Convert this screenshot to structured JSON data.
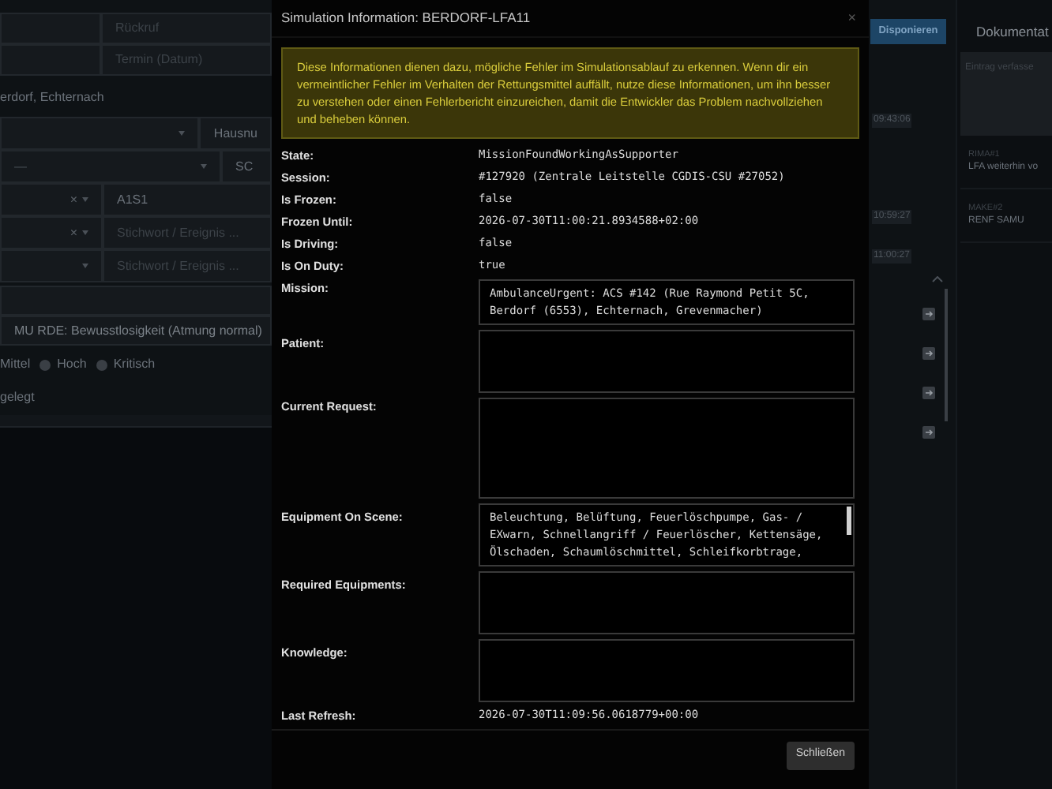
{
  "background": {
    "left": {
      "callback_placeholder": "Rückruf",
      "date_placeholder": "Termin (Datum)",
      "address": "erdorf, Echternach",
      "rows": [
        {
          "kind": "wide",
          "side_value": "Hausnu"
        },
        {
          "kind": "wide",
          "select_value": "—",
          "side_value": "SC"
        },
        {
          "kind": "narrow",
          "clear": "×",
          "side_value": "A1S1"
        },
        {
          "kind": "narrow",
          "clear": "×",
          "side_placeholder": "Stichwort / Ereignis ..."
        },
        {
          "kind": "narrow",
          "side_placeholder": "Stichwort / Ereignis ..."
        }
      ],
      "keyword": "MU RDE: Bewusstlosigkeit (Atmung normal)",
      "priority_cut_label": "Mittel",
      "priority_options": [
        {
          "label": "Hoch",
          "selected": false
        },
        {
          "label": "Kritisch",
          "selected": false
        }
      ],
      "status": "gelegt"
    },
    "right": {
      "dispatch_button": "Disponieren",
      "times": [
        "09:43:06",
        "10:59:27",
        "11:00:27"
      ],
      "documentation_title": "Dokumentat",
      "entry_placeholder": "Eintrag verfasse",
      "entries": [
        {
          "tag": "RIMA#1",
          "text": "LFA weiterhin vo"
        },
        {
          "tag": "MAKE#2",
          "text": "RENF SAMU"
        }
      ]
    }
  },
  "dialog": {
    "title": "Simulation Information: BERDORF-LFA11",
    "close": "×",
    "notice": "Diese Informationen dienen dazu, mögliche Fehler im Simulationsablauf zu erkennen. Wenn dir ein vermeintlicher Fehler im Verhalten der Rettungsmittel auffällt, nutze diese Informationen, um ihn besser zu verstehen oder einen Fehlerbericht einzureichen, damit die Entwickler das Problem nachvollziehen und beheben können.",
    "fields": [
      {
        "kind": "text",
        "label": "State:",
        "value": "MissionFoundWorkingAsSupporter"
      },
      {
        "kind": "text",
        "label": "Session:",
        "value": "#127920 (Zentrale Leitstelle CGDIS-CSU #27052)"
      },
      {
        "kind": "text",
        "label": "Is Frozen:",
        "value": "false"
      },
      {
        "kind": "text",
        "label": "Frozen Until:",
        "value": "2026-07-30T11:00:21.8934588+02:00"
      },
      {
        "kind": "text",
        "label": "Is Driving:",
        "value": "false"
      },
      {
        "kind": "text",
        "label": "Is On Duty:",
        "value": "true"
      },
      {
        "kind": "short",
        "label": "Mission:",
        "value": "AmbulanceUrgent: ACS #142 (Rue Raymond Petit 5C, Berdorf (6553), Echternach, Grevenmacher)"
      },
      {
        "kind": "area",
        "label": "Patient:"
      },
      {
        "kind": "tall",
        "label": "Current Request:"
      },
      {
        "kind": "area",
        "label": "Equipment On Scene:",
        "value": "Beleuchtung, Belüftung, Feuerlöschpumpe, Gas- / EXwarn, Schnellangriff / Feuerlöscher, Kettensäge, Ölschaden, Schaumlöschmittel, Schleifkorbtrage,",
        "scrollable": true
      },
      {
        "kind": "area",
        "label": "Required Equipments:"
      },
      {
        "kind": "area",
        "label": "Knowledge:"
      },
      {
        "kind": "text",
        "label": "Last Refresh:",
        "value": "2026-07-30T11:09:56.0618779+00:00"
      }
    ],
    "close_button": "Schließen"
  }
}
